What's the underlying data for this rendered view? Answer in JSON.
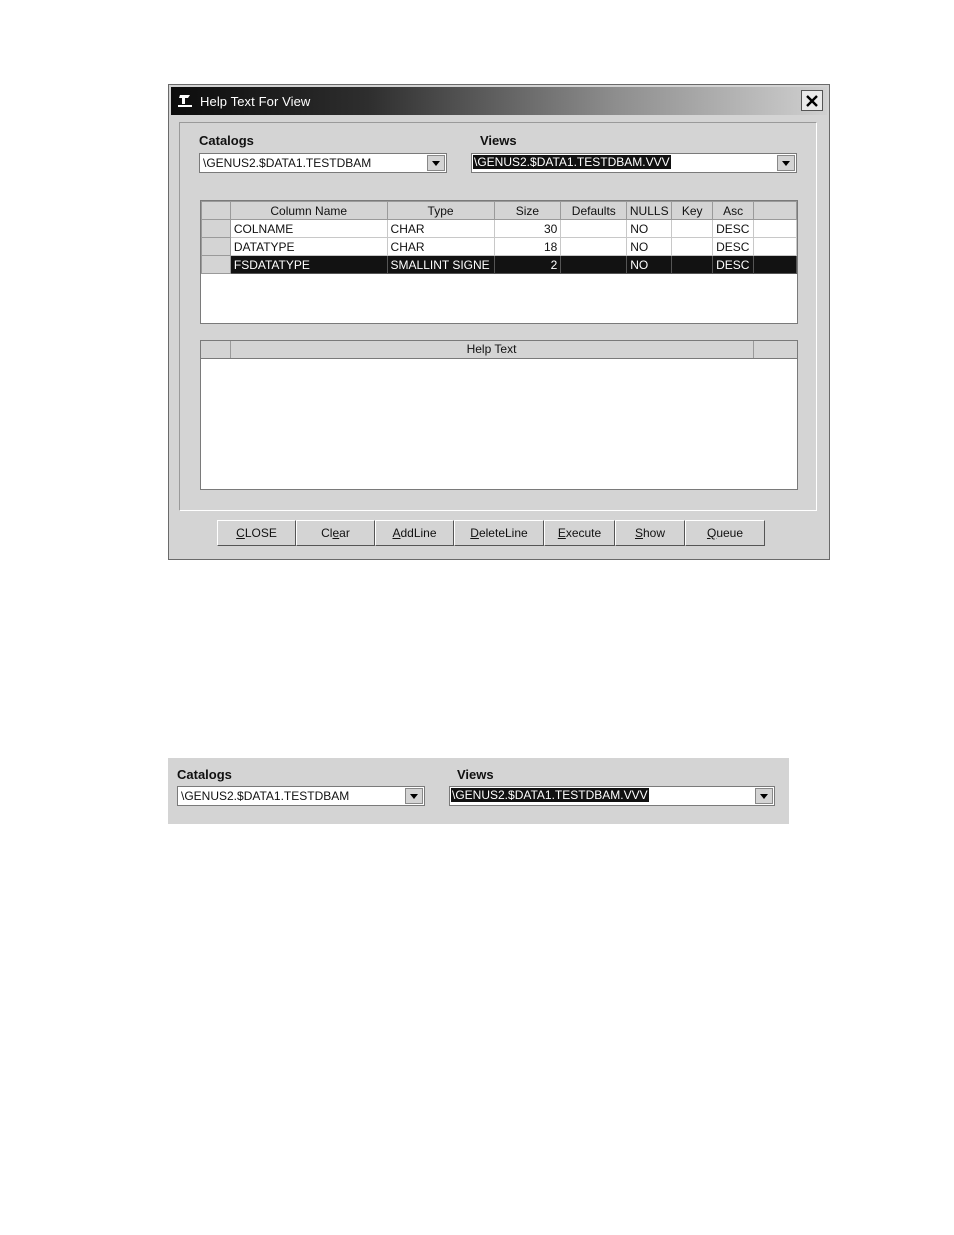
{
  "window": {
    "title": "Help Text  For View",
    "icon": "app-logo-icon",
    "close_icon": "close-icon"
  },
  "catalogs": {
    "label": "Catalogs",
    "value": "\\GENUS2.$DATA1.TESTDBAM"
  },
  "views": {
    "label": "Views",
    "value": "\\GENUS2.$DATA1.TESTDBAM.VVV"
  },
  "columns_grid": {
    "headers": [
      "Column Name",
      "Type",
      "Size",
      "Defaults",
      "NULLS",
      "Key",
      "Asc"
    ],
    "rows": [
      {
        "name": "COLNAME",
        "type": "CHAR",
        "size": "30",
        "defaults": "",
        "nulls": "NO",
        "key": "",
        "asc": "DESC"
      },
      {
        "name": "DATATYPE",
        "type": "CHAR",
        "size": "18",
        "defaults": "",
        "nulls": "NO",
        "key": "",
        "asc": "DESC"
      },
      {
        "name": "FSDATATYPE",
        "type": "SMALLINT SIGNE",
        "size": "2",
        "defaults": "",
        "nulls": "NO",
        "key": "",
        "asc": "DESC"
      }
    ],
    "selected_row": 2
  },
  "help_grid": {
    "header": "Help Text"
  },
  "buttons": [
    {
      "mnemonic": "C",
      "rest": "LOSE",
      "pre": ""
    },
    {
      "mnemonic": "e",
      "rest": "ar",
      "pre": "Cl"
    },
    {
      "mnemonic": "A",
      "rest": "ddLine",
      "pre": ""
    },
    {
      "mnemonic": "D",
      "rest": "eleteLine",
      "pre": ""
    },
    {
      "mnemonic": "E",
      "rest": "xecute",
      "pre": ""
    },
    {
      "mnemonic": "S",
      "rest": "how",
      "pre": ""
    },
    {
      "mnemonic": "Q",
      "rest": "ueue",
      "pre": ""
    }
  ],
  "zoom_panel": {
    "catalogs_label": "Catalogs",
    "catalogs_value": "\\GENUS2.$DATA1.TESTDBAM",
    "views_label": "Views",
    "views_value": "\\GENUS2.$DATA1.TESTDBAM.VVV"
  }
}
